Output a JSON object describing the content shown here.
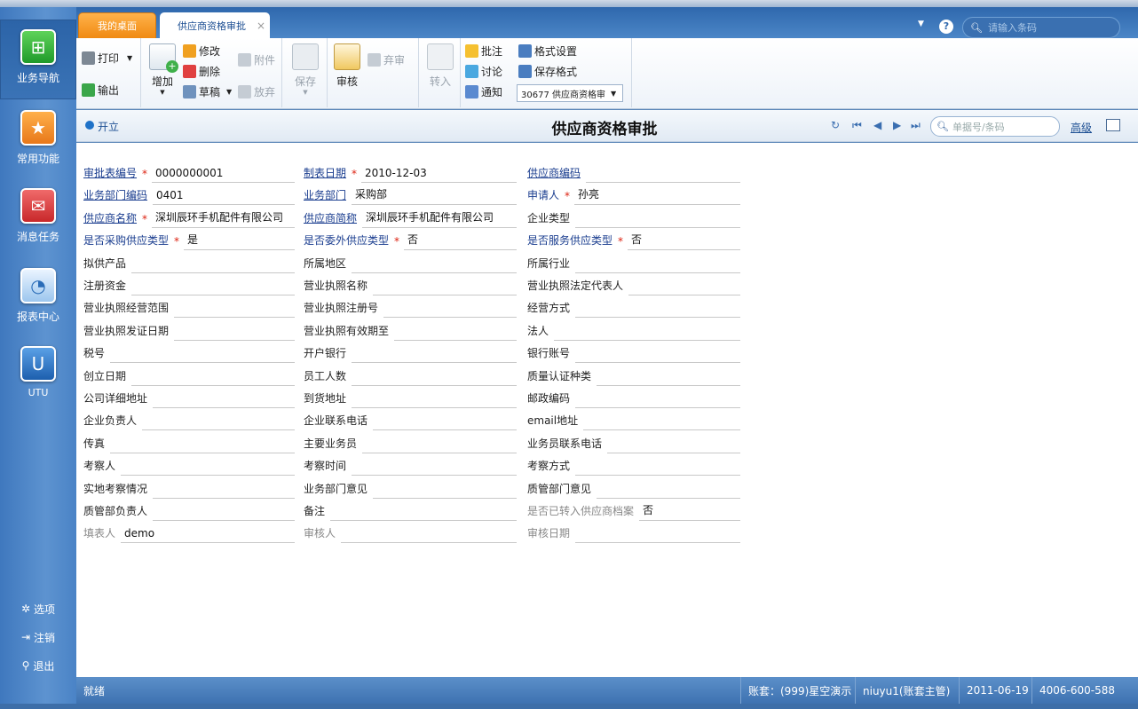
{
  "leftnav": {
    "items": [
      {
        "label": "业务导航",
        "icon": "business-tree-icon"
      },
      {
        "label": "常用功能",
        "icon": "star-icon"
      },
      {
        "label": "消息任务",
        "icon": "envelope-icon"
      },
      {
        "label": "报表中心",
        "icon": "report-chart-icon"
      },
      {
        "label": "UTU",
        "icon": "utu-icon"
      }
    ],
    "bottom": [
      {
        "label": "选项",
        "icon": "gear-icon"
      },
      {
        "label": "注销",
        "icon": "logout-icon"
      },
      {
        "label": "退出",
        "icon": "key-icon"
      }
    ]
  },
  "tabs": {
    "home": "我的桌面",
    "active": "供应商资格审批",
    "close": "×"
  },
  "topbar": {
    "search_placeholder": "请输入条码",
    "help": "?"
  },
  "toolbar": {
    "print": "打印",
    "export": "输出",
    "add": "增加",
    "edit": "修改",
    "delete": "删除",
    "draft": "草稿",
    "attach": "附件",
    "discard": "放弃",
    "save": "保存",
    "audit": "审核",
    "abandon": "弃审",
    "transfer": "转入",
    "annotate": "批注",
    "discuss": "讨论",
    "notify": "通知",
    "format_settings": "格式设置",
    "save_format": "保存格式",
    "format_select": "30677 供应商资格审"
  },
  "header": {
    "status": "开立",
    "title": "供应商资格审批",
    "search_placeholder": "单据号/条码",
    "advanced": "高级"
  },
  "form": {
    "rows": [
      [
        {
          "label": "审批表编号",
          "value": "0000000001",
          "req": true,
          "link": true
        },
        {
          "label": "制表日期",
          "value": "2010-12-03",
          "req": true,
          "link": true
        },
        {
          "label": "供应商编码",
          "value": "",
          "link": true
        }
      ],
      [
        {
          "label": "业务部门编码",
          "value": "0401",
          "link": true
        },
        {
          "label": "业务部门",
          "value": "采购部",
          "link": true
        },
        {
          "label": "申请人",
          "value": "孙亮",
          "req": true,
          "blue": true
        }
      ],
      [
        {
          "label": "供应商名称",
          "value": "深圳辰环手机配件有限公司",
          "req": true,
          "link": true
        },
        {
          "label": "供应商简称",
          "value": "深圳辰环手机配件有限公司",
          "link": true
        },
        {
          "label": "企业类型",
          "value": ""
        }
      ],
      [
        {
          "label": "是否采购供应类型",
          "value": "是",
          "req": true,
          "blue": true
        },
        {
          "label": "是否委外供应类型",
          "value": "否",
          "req": true,
          "blue": true
        },
        {
          "label": "是否服务供应类型",
          "value": "否",
          "req": true,
          "blue": true
        }
      ],
      [
        {
          "label": "拟供产品",
          "value": ""
        },
        {
          "label": "所属地区",
          "value": ""
        },
        {
          "label": "所属行业",
          "value": ""
        }
      ],
      [
        {
          "label": "注册资金",
          "value": ""
        },
        {
          "label": "营业执照名称",
          "value": ""
        },
        {
          "label": "营业执照法定代表人",
          "value": ""
        }
      ],
      [
        {
          "label": "营业执照经营范围",
          "value": ""
        },
        {
          "label": "营业执照注册号",
          "value": ""
        },
        {
          "label": "经营方式",
          "value": ""
        }
      ],
      [
        {
          "label": "营业执照发证日期",
          "value": ""
        },
        {
          "label": "营业执照有效期至",
          "value": ""
        },
        {
          "label": "法人",
          "value": ""
        }
      ],
      [
        {
          "label": "税号",
          "value": ""
        },
        {
          "label": "开户银行",
          "value": ""
        },
        {
          "label": "银行账号",
          "value": ""
        }
      ],
      [
        {
          "label": "创立日期",
          "value": ""
        },
        {
          "label": "员工人数",
          "value": ""
        },
        {
          "label": "质量认证种类",
          "value": ""
        }
      ],
      [
        {
          "label": "公司详细地址",
          "value": ""
        },
        {
          "label": "到货地址",
          "value": ""
        },
        {
          "label": "邮政编码",
          "value": ""
        }
      ],
      [
        {
          "label": "企业负责人",
          "value": ""
        },
        {
          "label": "企业联系电话",
          "value": ""
        },
        {
          "label": "email地址",
          "value": ""
        }
      ],
      [
        {
          "label": "传真",
          "value": ""
        },
        {
          "label": "主要业务员",
          "value": ""
        },
        {
          "label": "业务员联系电话",
          "value": ""
        }
      ],
      [
        {
          "label": "考察人",
          "value": ""
        },
        {
          "label": "考察时间",
          "value": ""
        },
        {
          "label": "考察方式",
          "value": ""
        }
      ],
      [
        {
          "label": "实地考察情况",
          "value": ""
        },
        {
          "label": "业务部门意见",
          "value": ""
        },
        {
          "label": "质管部门意见",
          "value": ""
        }
      ],
      [
        {
          "label": "质管部负责人",
          "value": ""
        },
        {
          "label": "备注",
          "value": ""
        },
        {
          "label": "是否已转入供应商档案",
          "value": "否",
          "grey": true
        }
      ],
      [
        {
          "label": "填表人",
          "value": "demo",
          "grey": true
        },
        {
          "label": "审核人",
          "value": "",
          "grey": true
        },
        {
          "label": "审核日期",
          "value": "",
          "grey": true
        }
      ]
    ]
  },
  "statusbar": {
    "ready": "就绪",
    "account": "账套：(999)星空演示",
    "user": "niuyu1(账套主管)",
    "date": "2011-06-19",
    "phone": "4006-600-588"
  },
  "colors": {
    "accent": "#1d4f93",
    "required_star": "#dd2211",
    "nav_bg": "#4a83c6"
  }
}
